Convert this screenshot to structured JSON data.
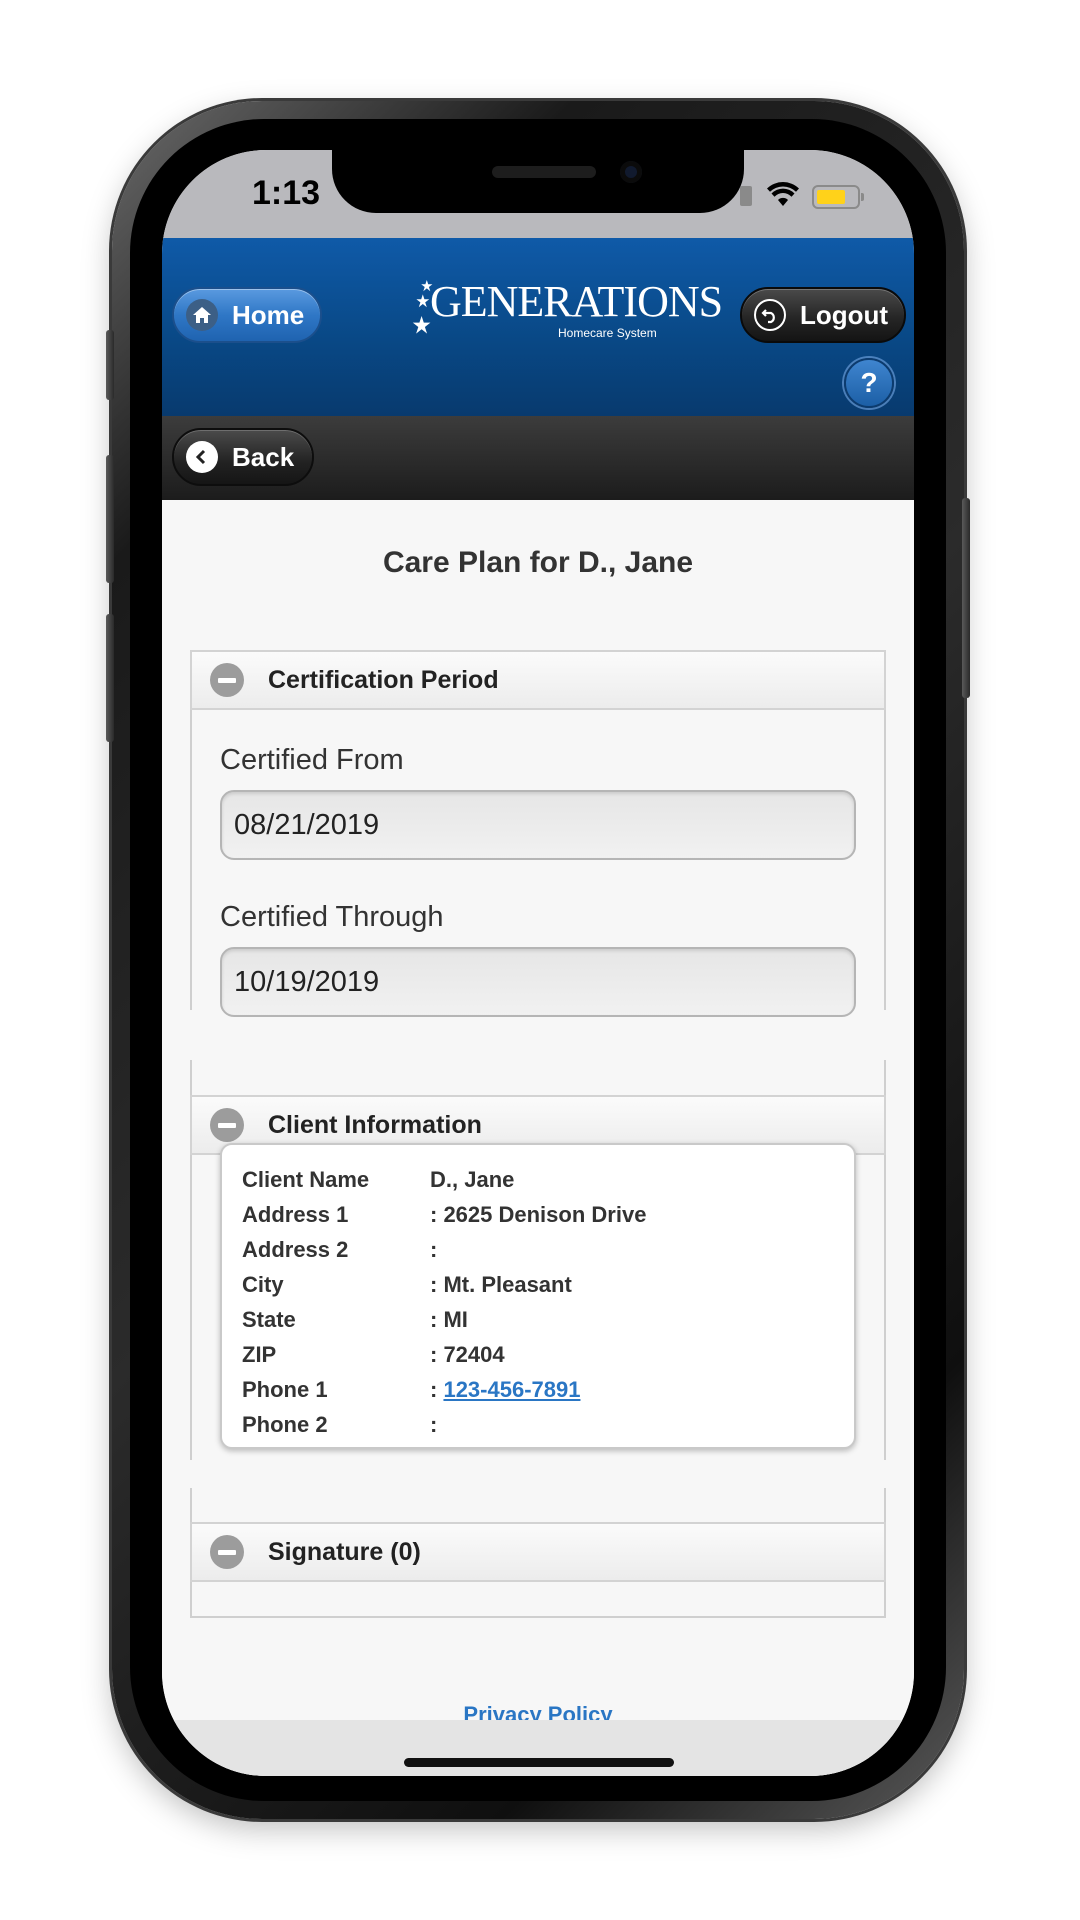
{
  "status_bar": {
    "time": "1:13"
  },
  "header": {
    "home_label": "Home",
    "logout_label": "Logout",
    "logo_text": "GENERATIONS",
    "logo_subtext": "Homecare System",
    "help_label": "?"
  },
  "nav": {
    "back_label": "Back"
  },
  "page": {
    "title": "Care Plan for D., Jane"
  },
  "certification": {
    "section_title": "Certification Period",
    "from_label": "Certified From",
    "from_value": "08/21/2019",
    "through_label": "Certified Through",
    "through_value": "10/19/2019"
  },
  "client_info": {
    "section_title": "Client Information",
    "rows": [
      {
        "label": "Client Name",
        "value": "D., Jane"
      },
      {
        "label": "Address 1",
        "value": ": 2625 Denison Drive"
      },
      {
        "label": "Address 2",
        "value": ":"
      },
      {
        "label": "City",
        "value": ": Mt. Pleasant"
      },
      {
        "label": "State",
        "value": ": MI"
      },
      {
        "label": "ZIP",
        "value": ": 72404"
      },
      {
        "label": "Phone 1",
        "value_prefix": ": ",
        "value_link": "123-456-7891"
      },
      {
        "label": "Phone 2",
        "value": ":"
      }
    ]
  },
  "signature": {
    "section_title": "Signature (0)"
  },
  "footer": {
    "privacy_label": "Privacy Policy"
  },
  "colors": {
    "header_blue": "#094987",
    "link_blue": "#2a76c4",
    "battery_yellow": "#ffd21a"
  },
  "icons": [
    "home-icon",
    "logout-icon",
    "help-icon",
    "back-chevron-icon",
    "collapse-minus-icon",
    "wifi-icon",
    "battery-icon"
  ]
}
